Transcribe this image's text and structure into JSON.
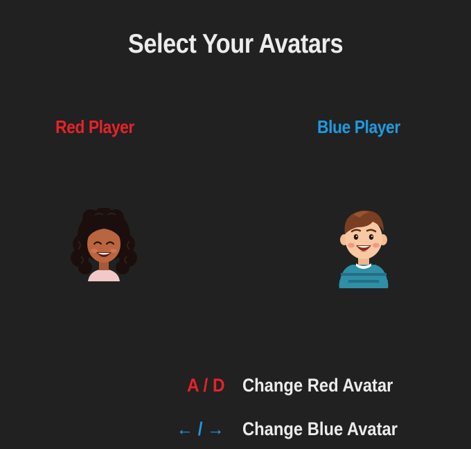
{
  "screen": {
    "title": "Select Your Avatars",
    "background_color": "#212121"
  },
  "players": [
    {
      "label": "Red Player",
      "color": "#e8222a",
      "avatar_icon": "girl-curly-hair-avatar-icon"
    },
    {
      "label": "Blue Player",
      "color": "#1e9ae0",
      "avatar_icon": "boy-teal-shirt-avatar-icon"
    }
  ],
  "controls": [
    {
      "keys": "A / D",
      "action": "Change Red Avatar",
      "color": "#e8222a"
    },
    {
      "keys": "← / →",
      "action": "Change Blue Avatar",
      "color": "#1e9ae0"
    }
  ]
}
